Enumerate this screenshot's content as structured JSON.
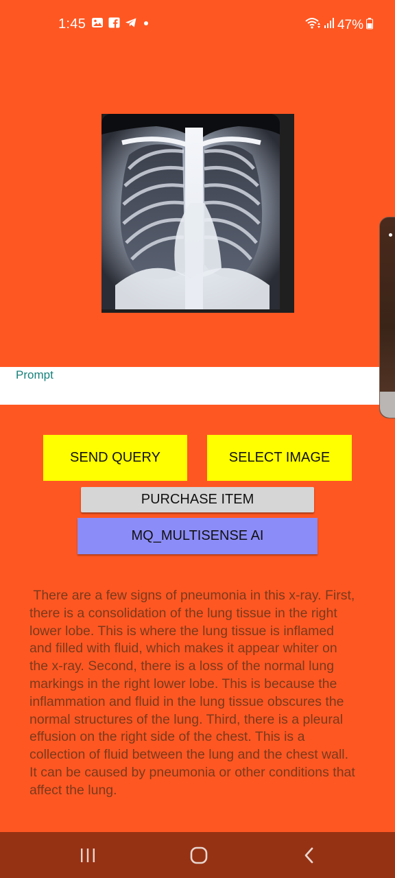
{
  "status_bar": {
    "time": "1:45",
    "battery_percent": "47%",
    "left_icons": [
      "gallery-icon",
      "facebook-icon",
      "telegram-icon",
      "dot-icon"
    ],
    "right_icons": [
      "wifi-icon",
      "signal-icon",
      "battery-icon"
    ]
  },
  "image": {
    "subject": "chest-xray-image"
  },
  "prompt": {
    "placeholder": "Prompt",
    "value": ""
  },
  "buttons": {
    "send_query": "SEND QUERY",
    "select_image": "SELECT IMAGE",
    "purchase_item": "PURCHASE ITEM",
    "multisense": "MQ_MULTISENSE AI"
  },
  "response": " There are a few signs of pneumonia in this x-ray. First, there is a consolidation of the lung tissue in the right lower lobe. This is where the lung tissue is inflamed and filled with fluid, which makes it appear whiter on the x-ray. Second, there is a loss of the normal lung markings in the right lower lobe. This is because the inflammation and fluid in the lung tissue obscures the normal structures of the lung. Third, there is a pleural effusion on the right side of the chest. This is a collection of fluid between the lung and the chest wall. It can be caused by pneumonia or other conditions that affect the lung.",
  "colors": {
    "background": "#ff5722",
    "button_yellow": "#ffff00",
    "button_grey": "#d6d6d6",
    "button_purple": "#8c8cf8",
    "response_text": "#7a3a1c",
    "nav_bar": "#963214",
    "prompt_label": "#17807a"
  },
  "nav_bar": {
    "items": [
      "recents-icon",
      "home-icon",
      "back-icon"
    ]
  }
}
